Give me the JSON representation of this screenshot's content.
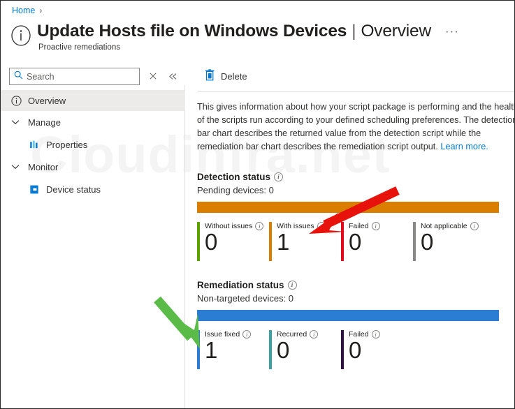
{
  "breadcrumb": {
    "home": "Home",
    "separator": "›"
  },
  "header": {
    "icon": "info-circle-icon",
    "title": "Update Hosts file on Windows Devices",
    "divider": "|",
    "view": "Overview",
    "subtitle": "Proactive remediations",
    "more_label": "···"
  },
  "search": {
    "placeholder": "Search",
    "value": "",
    "icon": "search-icon",
    "clear_icon": "×",
    "collapse_icon": "«"
  },
  "sidebar": {
    "items": [
      {
        "label": "Overview",
        "icon": "info-circle-icon",
        "selected": true
      },
      {
        "label": "Manage",
        "type": "group",
        "expanded": true
      },
      {
        "label": "Properties",
        "icon": "properties-bars-icon",
        "type": "child"
      },
      {
        "label": "Monitor",
        "type": "group",
        "expanded": true
      },
      {
        "label": "Device status",
        "icon": "device-status-icon",
        "type": "child"
      }
    ]
  },
  "toolbar": {
    "delete_label": "Delete",
    "delete_icon": "trash-icon"
  },
  "main": {
    "description": "This gives information about how your script package is performing and the health of the scripts run according to your defined scheduling preferences. The detection bar chart describes the returned value from the detection script while the remediation bar chart describes the remediation script output.",
    "learn_more": "Learn more."
  },
  "watermark": {
    "text": "Cloudinfra.net"
  },
  "chart_data": [
    {
      "type": "bar",
      "title": "Detection status",
      "subtitle": "Pending devices: 0",
      "bar_color": "#D97E00",
      "bar_fill_pct": 100,
      "categories": [
        "Without issues",
        "With issues",
        "Failed",
        "Not applicable"
      ],
      "values": [
        0,
        1,
        0,
        0
      ],
      "colors": [
        "#5BA300",
        "#D97E00",
        "#E00B1C",
        "#8A8886"
      ],
      "legend": "inline-cards",
      "info_icon": "info-circle-icon"
    },
    {
      "type": "bar",
      "title": "Remediation status",
      "subtitle": "Non-targeted devices: 0",
      "bar_color": "#2B7CD3",
      "bar_fill_pct": 100,
      "categories": [
        "Issue fixed",
        "Recurred",
        "Failed"
      ],
      "values": [
        1,
        0,
        0
      ],
      "colors": [
        "#2B7CD3",
        "#3AA0A1",
        "#2D1441"
      ],
      "legend": "inline-cards",
      "info_icon": "info-circle-icon"
    }
  ],
  "annotations": [
    {
      "name": "red-arrow",
      "color": "#E8120C",
      "points_to": "With issues"
    },
    {
      "name": "green-arrow",
      "color": "#5BBB48",
      "points_to": "Issue fixed"
    }
  ]
}
